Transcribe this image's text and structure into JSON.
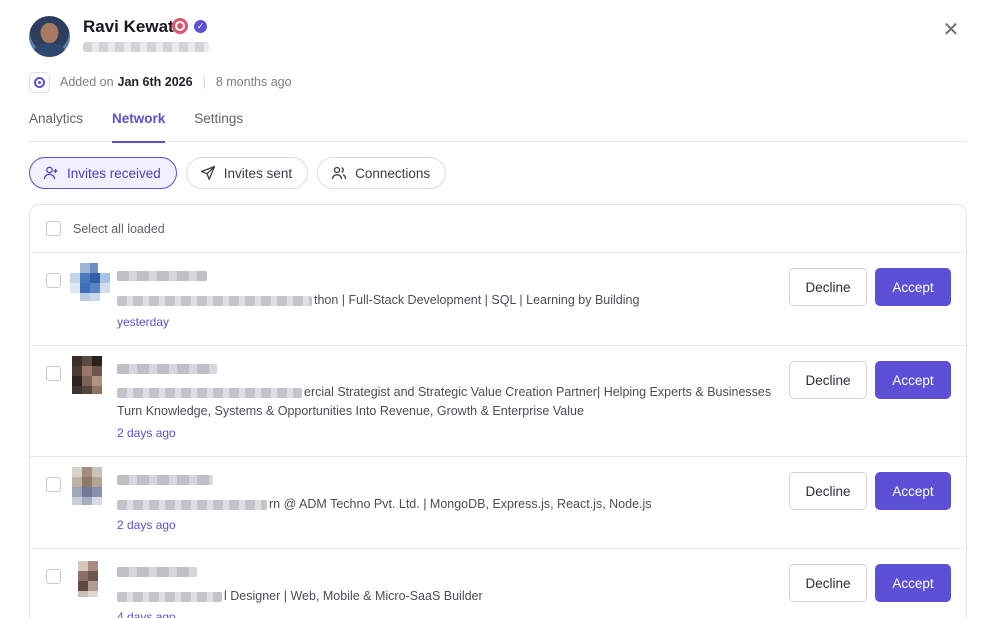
{
  "profile": {
    "name": "Ravi Kewat",
    "badges": [
      "target-icon",
      "verified-icon"
    ],
    "added_label": "Added on",
    "added_date": "Jan 6th 2026",
    "added_relative": "8 months ago"
  },
  "tabs": [
    {
      "label": "Analytics",
      "active": false
    },
    {
      "label": "Network",
      "active": true
    },
    {
      "label": "Settings",
      "active": false
    }
  ],
  "filters": [
    {
      "label": "Invites received",
      "icon": "user-plus-icon",
      "active": true
    },
    {
      "label": "Invites sent",
      "icon": "send-icon",
      "active": false
    },
    {
      "label": "Connections",
      "icon": "users-icon",
      "active": false
    }
  ],
  "list": {
    "select_all_label": "Select all loaded",
    "invites": [
      {
        "headline": "thon | Full-Stack Development | SQL | Learning by Building",
        "time": "yesterday"
      },
      {
        "headline": "ercial Strategist and Strategic Value Creation Partner| Helping Experts & Businesses",
        "headline_2": "Turn Knowledge, Systems & Opportunities Into Revenue, Growth & Enterprise Value",
        "time": "2 days ago"
      },
      {
        "headline": "rn @ ADM Techno Pvt. Ltd. | MongoDB, Express.js, React.js, Node.js",
        "time": "2 days ago"
      },
      {
        "headline": "l Designer | Web, Mobile & Micro-SaaS Builder",
        "time": "4 days ago"
      }
    ],
    "decline_label": "Decline",
    "accept_label": "Accept"
  },
  "colors": {
    "accent": "#5b50d6",
    "border": "#e3e4e9"
  }
}
